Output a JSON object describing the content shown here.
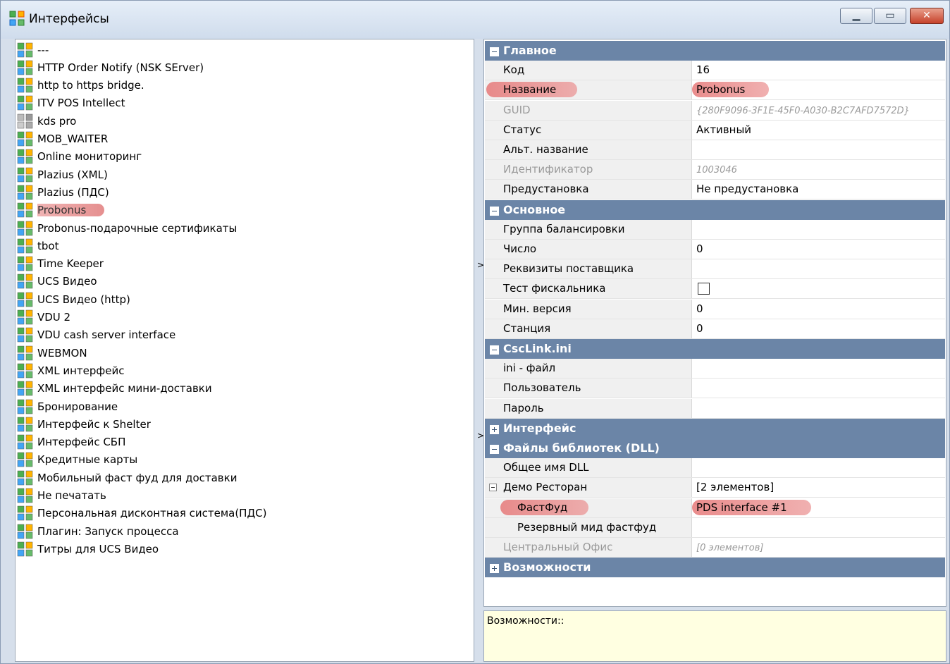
{
  "window": {
    "title": "Интерфейсы"
  },
  "tree": [
    {
      "label": "---",
      "state": "normal"
    },
    {
      "label": "HTTP Order Notify (NSK SErver)",
      "state": "normal"
    },
    {
      "label": "http to https bridge.",
      "state": "normal"
    },
    {
      "label": "ITV POS Intellect",
      "state": "normal"
    },
    {
      "label": "kds pro",
      "state": "inactive"
    },
    {
      "label": "MOB_WAITER",
      "state": "normal"
    },
    {
      "label": "Online мониторинг",
      "state": "normal"
    },
    {
      "label": "Plazius (XML)",
      "state": "normal"
    },
    {
      "label": "Plazius (ПДС)",
      "state": "normal"
    },
    {
      "label": "Probonus",
      "state": "selected"
    },
    {
      "label": "Probonus-подарочные сертификаты",
      "state": "normal"
    },
    {
      "label": "tbot",
      "state": "normal"
    },
    {
      "label": "Time Keeper",
      "state": "normal"
    },
    {
      "label": "UCS Видео",
      "state": "normal"
    },
    {
      "label": "UCS Видео (http)",
      "state": "normal"
    },
    {
      "label": "VDU 2",
      "state": "normal"
    },
    {
      "label": "VDU cash server interface",
      "state": "normal"
    },
    {
      "label": "WEBMON",
      "state": "normal"
    },
    {
      "label": "XML интерфейс",
      "state": "normal"
    },
    {
      "label": "XML интерфейс мини-доставки",
      "state": "normal"
    },
    {
      "label": "Бронирование",
      "state": "normal"
    },
    {
      "label": "Интерфейс к Shelter",
      "state": "normal"
    },
    {
      "label": "Интерфейс СБП",
      "state": "normal"
    },
    {
      "label": "Кредитные карты",
      "state": "normal"
    },
    {
      "label": "Мобильный фаст фуд для доставки",
      "state": "normal"
    },
    {
      "label": "Не печатать",
      "state": "normal"
    },
    {
      "label": "Персональная дисконтная система(ПДС)",
      "state": "normal"
    },
    {
      "label": "Плагин: Запуск процесса",
      "state": "normal"
    },
    {
      "label": "Титры для UCS Видео",
      "state": "normal"
    }
  ],
  "properties": [
    {
      "kind": "cat",
      "label": "Главное",
      "expanded": true
    },
    {
      "kind": "row",
      "name": "Код",
      "value": "16"
    },
    {
      "kind": "row",
      "name": "Название",
      "value": "Probonus",
      "highlight": true
    },
    {
      "kind": "row",
      "name": "GUID",
      "value": "{280F9096-3F1E-45F0-A030-B2C7AFD7572D}",
      "disabled": true,
      "italic": true
    },
    {
      "kind": "row",
      "name": "Статус",
      "value": "Активный"
    },
    {
      "kind": "row",
      "name": "Альт. название",
      "value": ""
    },
    {
      "kind": "row",
      "name": "Идентификатор",
      "value": "1003046",
      "disabled": true,
      "italic": true
    },
    {
      "kind": "row",
      "name": "Предустановка",
      "value": "Не предустановка"
    },
    {
      "kind": "cat",
      "label": "Основное",
      "expanded": true
    },
    {
      "kind": "row",
      "name": "Группа балансировки",
      "value": ""
    },
    {
      "kind": "row",
      "name": "Число",
      "value": "0"
    },
    {
      "kind": "row",
      "name": "Реквизиты поставщика",
      "value": ""
    },
    {
      "kind": "row",
      "name": "Тест фискальника",
      "value": "",
      "checkbox": true
    },
    {
      "kind": "row",
      "name": "Мин. версия",
      "value": "0"
    },
    {
      "kind": "row",
      "name": "Станция",
      "value": "0"
    },
    {
      "kind": "cat",
      "label": "CscLink.ini",
      "expanded": true
    },
    {
      "kind": "row",
      "name": "ini - файл",
      "value": ""
    },
    {
      "kind": "row",
      "name": "Пользователь",
      "value": ""
    },
    {
      "kind": "row",
      "name": "Пароль",
      "value": ""
    },
    {
      "kind": "cat",
      "label": "Интерфейс",
      "expanded": false
    },
    {
      "kind": "cat",
      "label": "Файлы библиотек (DLL)",
      "expanded": true
    },
    {
      "kind": "row",
      "name": "Общее имя DLL",
      "value": ""
    },
    {
      "kind": "row",
      "name": "Демо Ресторан",
      "value": "[2 элементов]",
      "sub": true
    },
    {
      "kind": "row",
      "name": "ФастФуд",
      "value": "PDS interface #1",
      "indent": true,
      "highlight": true
    },
    {
      "kind": "row",
      "name": "Резервный мид фастфуд",
      "value": "",
      "indent": true
    },
    {
      "kind": "row",
      "name": "Центральный Офис",
      "value": "[0 элементов]",
      "disabled": true,
      "italic": true
    },
    {
      "kind": "cat",
      "label": "Возможности",
      "expanded": false
    }
  ],
  "description": "Возможности::",
  "colors": {
    "category": "#6b85a7",
    "selection": "#e58f8f",
    "descBg": "#ffffe1"
  }
}
